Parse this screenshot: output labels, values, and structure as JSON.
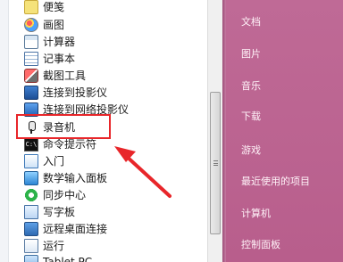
{
  "start_menu": {
    "programs": [
      {
        "label": "便笺",
        "icon": "sticky-notes-icon"
      },
      {
        "label": "画图",
        "icon": "paint-icon"
      },
      {
        "label": "计算器",
        "icon": "calculator-icon"
      },
      {
        "label": "记事本",
        "icon": "notepad-icon"
      },
      {
        "label": "截图工具",
        "icon": "snipping-tool-icon"
      },
      {
        "label": "连接到投影仪",
        "icon": "projector-icon"
      },
      {
        "label": "连接到网络投影仪",
        "icon": "network-projector-icon"
      },
      {
        "label": "录音机",
        "icon": "microphone-icon"
      },
      {
        "label": "命令提示符",
        "icon": "command-prompt-icon"
      },
      {
        "label": "入门",
        "icon": "getting-started-icon"
      },
      {
        "label": "数学输入面板",
        "icon": "math-input-panel-icon"
      },
      {
        "label": "同步中心",
        "icon": "sync-center-icon"
      },
      {
        "label": "写字板",
        "icon": "wordpad-icon"
      },
      {
        "label": "远程桌面连接",
        "icon": "remote-desktop-icon"
      },
      {
        "label": "运行",
        "icon": "run-icon"
      },
      {
        "label": "Tablet PC",
        "icon": "tablet-pc-icon"
      }
    ],
    "highlighted_item": "录音机",
    "right_pane": [
      {
        "label": "文档"
      },
      {
        "label": "图片"
      },
      {
        "label": "音乐"
      },
      {
        "label": "下载"
      },
      {
        "label": "游戏"
      },
      {
        "label": "最近使用的项目"
      },
      {
        "label": "计算机"
      },
      {
        "label": "控制面板"
      }
    ],
    "colors": {
      "highlight": "#e8262a",
      "right_pane_bg": "#bf6a96",
      "right_pane_text": "#fff2f8"
    }
  }
}
